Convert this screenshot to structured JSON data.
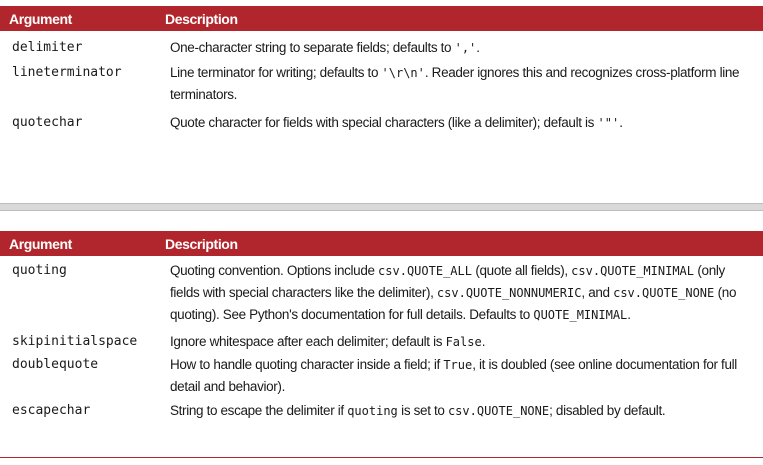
{
  "tables": [
    {
      "header": {
        "argument": "Argument",
        "description": "Description"
      },
      "rows": [
        {
          "argument": "delimiter",
          "description": [
            {
              "t": "text",
              "v": "One-character string to separate fields; defaults to "
            },
            {
              "t": "code",
              "v": "','"
            },
            {
              "t": "text",
              "v": "."
            }
          ]
        },
        {
          "argument": "lineterminator",
          "description": [
            {
              "t": "text",
              "v": "Line terminator for writing; defaults to "
            },
            {
              "t": "code",
              "v": "'\\r\\n'"
            },
            {
              "t": "text",
              "v": ". Reader ignores this and recognizes cross-platform line terminators."
            }
          ]
        },
        {
          "argument": "quotechar",
          "description": [
            {
              "t": "text",
              "v": "Quote character for fields with special characters (like a delimiter); default is "
            },
            {
              "t": "code",
              "v": "'\"'"
            },
            {
              "t": "text",
              "v": "."
            }
          ]
        }
      ]
    },
    {
      "header": {
        "argument": "Argument",
        "description": "Description"
      },
      "rows": [
        {
          "argument": "quoting",
          "description": [
            {
              "t": "text",
              "v": "Quoting convention. Options include "
            },
            {
              "t": "code",
              "v": "csv.QUOTE_ALL"
            },
            {
              "t": "text",
              "v": " (quote all fields), "
            },
            {
              "t": "code",
              "v": "csv.QUOTE_MINIMAL"
            },
            {
              "t": "text",
              "v": " (only fields with special characters like the delimiter), "
            },
            {
              "t": "code",
              "v": "csv.QUOTE_NONNUMERIC"
            },
            {
              "t": "text",
              "v": ", and "
            },
            {
              "t": "code",
              "v": "csv.QUOTE_NONE"
            },
            {
              "t": "text",
              "v": " (no quoting). See Python's documentation for full details. Defaults to "
            },
            {
              "t": "code",
              "v": "QUOTE_MINIMAL"
            },
            {
              "t": "text",
              "v": "."
            }
          ]
        },
        {
          "argument": "skipinitialspace",
          "description": [
            {
              "t": "text",
              "v": "Ignore whitespace after each delimiter; default is "
            },
            {
              "t": "code",
              "v": "False"
            },
            {
              "t": "text",
              "v": "."
            }
          ]
        },
        {
          "argument": "doublequote",
          "description": [
            {
              "t": "text",
              "v": "How to handle quoting character inside a field; if "
            },
            {
              "t": "code",
              "v": "True"
            },
            {
              "t": "text",
              "v": ", it is doubled (see online documentation for full detail and behavior)."
            }
          ]
        },
        {
          "argument": "escapechar",
          "description": [
            {
              "t": "text",
              "v": "String to escape the delimiter if "
            },
            {
              "t": "code",
              "v": "quoting"
            },
            {
              "t": "text",
              "v": " is set to "
            },
            {
              "t": "code",
              "v": "csv.QUOTE_NONE"
            },
            {
              "t": "text",
              "v": "; disabled by default."
            }
          ]
        }
      ]
    }
  ],
  "colors": {
    "header_bg": "#b1262c",
    "header_text": "#ffffff",
    "divider": "#d9d9d9"
  }
}
